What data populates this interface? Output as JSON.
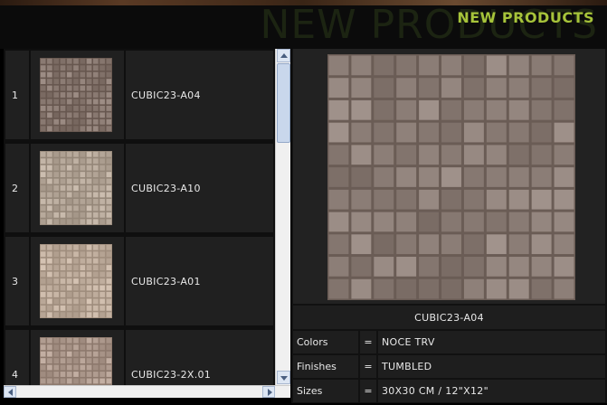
{
  "header": {
    "title": "NEW PRODUCTS",
    "watermark": "NEW PRODUCTS"
  },
  "list": [
    {
      "index": "1",
      "code": "CUBIC23-A04",
      "tone": "#8a7a72"
    },
    {
      "index": "2",
      "code": "CUBIC23-A10",
      "tone": "#b8aa9c"
    },
    {
      "index": "3",
      "code": "CUBIC23-A01",
      "tone": "#c2b0a0"
    },
    {
      "index": "4",
      "code": "CUBIC23-2X.01",
      "tone": "#b09c90"
    }
  ],
  "detail": {
    "name": "CUBIC23-A04",
    "specs": [
      {
        "label": "Colors",
        "eq": "=",
        "value": "NOCE TRV"
      },
      {
        "label": "Finishes",
        "eq": "=",
        "value": "TUMBLED"
      },
      {
        "label": "Sizes",
        "eq": "=",
        "value": "30X30 CM / 12\"X12\""
      }
    ],
    "tile_tone": "#8d7f78"
  },
  "colors": {
    "accent": "#a6c33a",
    "panel": "#202020",
    "background": "#000000"
  }
}
